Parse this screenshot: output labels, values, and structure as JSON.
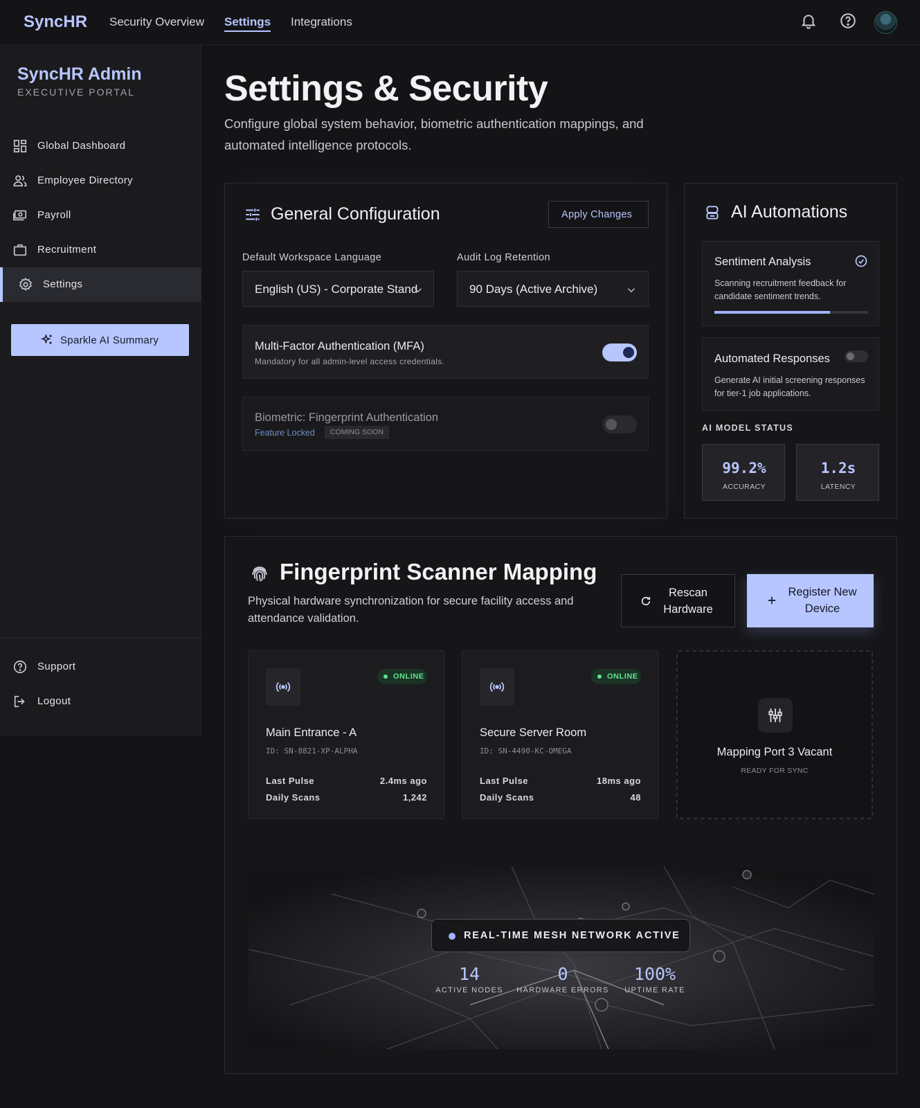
{
  "app": {
    "brand": "SyncHR"
  },
  "topnav": {
    "items": [
      "Security Overview",
      "Settings",
      "Integrations"
    ],
    "active_index": 1
  },
  "sidebar": {
    "title": "SyncHR Admin",
    "subtitle": "EXECUTIVE PORTAL",
    "items": [
      {
        "label": "Global Dashboard",
        "icon": "dashboard-icon"
      },
      {
        "label": "Employee Directory",
        "icon": "users-icon"
      },
      {
        "label": "Payroll",
        "icon": "payments-icon"
      },
      {
        "label": "Recruitment",
        "icon": "briefcase-icon"
      },
      {
        "label": "Settings",
        "icon": "gear-icon",
        "active": true
      }
    ],
    "sparkle_button": "Sparkle AI Summary",
    "footer": [
      {
        "label": "Support",
        "icon": "help-icon"
      },
      {
        "label": "Logout",
        "icon": "logout-icon"
      }
    ]
  },
  "header": {
    "title": "Settings & Security",
    "description": "Configure global system behavior, biometric authentication mappings, and automated intelligence protocols."
  },
  "general": {
    "title": "General Configuration",
    "apply_button": "Apply Changes",
    "language_label": "Default Workspace Language",
    "language_value": "English (US) - Corporate Standard",
    "retention_label": "Audit Log Retention",
    "retention_value": "90 Days (Active Archive)",
    "mfa": {
      "title": "Multi-Factor Authentication (MFA)",
      "desc": "Mandatory for all admin-level access credentials.",
      "enabled": true
    },
    "biometric": {
      "title": "Biometric: Fingerprint Authentication",
      "locked": "Feature Locked",
      "badge": "COMING SOON",
      "enabled": false
    }
  },
  "ai": {
    "title": "AI Automations",
    "sentiment": {
      "title": "Sentiment Analysis",
      "desc": "Scanning recruitment feedback for candidate sentiment trends.",
      "progress": 0.75,
      "enabled": true
    },
    "responses": {
      "title": "Automated Responses",
      "desc": "Generate AI initial screening responses for tier-1 job applications.",
      "enabled": false
    },
    "status_label": "AI MODEL STATUS",
    "accuracy": {
      "value": "99.2%",
      "label": "ACCURACY"
    },
    "latency": {
      "value": "1.2s",
      "label": "LATENCY"
    }
  },
  "fingerprint": {
    "title": "Fingerprint Scanner Mapping",
    "desc": "Physical hardware synchronization for secure facility access and attendance validation.",
    "rescan_button": "Rescan Hardware",
    "register_button": "Register New Device",
    "devices": [
      {
        "name": "Main Entrance - A",
        "id": "ID: SN-8821-XP-ALPHA",
        "status": "ONLINE",
        "pulse_label": "Last Pulse",
        "pulse": "2.4ms ago",
        "scans_label": "Daily Scans",
        "scans": "1,242"
      },
      {
        "name": "Secure Server Room",
        "id": "ID: SN-4490-KC-OMEGA",
        "status": "ONLINE",
        "pulse_label": "Last Pulse",
        "pulse": "18ms ago",
        "scans_label": "Daily Scans",
        "scans": "48"
      }
    ],
    "vacant": {
      "title": "Mapping Port 3 Vacant",
      "sub": "READY FOR SYNC"
    },
    "mesh": {
      "badge": "REAL-TIME MESH NETWORK ACTIVE",
      "stats": [
        {
          "value": "14",
          "label": "ACTIVE NODES"
        },
        {
          "value": "0",
          "label": "HARDWARE ERRORS"
        },
        {
          "value": "100%",
          "label": "UPTIME RATE"
        }
      ]
    }
  },
  "colors": {
    "accent": "#b7c6ff",
    "background": "#141416",
    "online": "#5ee38f"
  }
}
